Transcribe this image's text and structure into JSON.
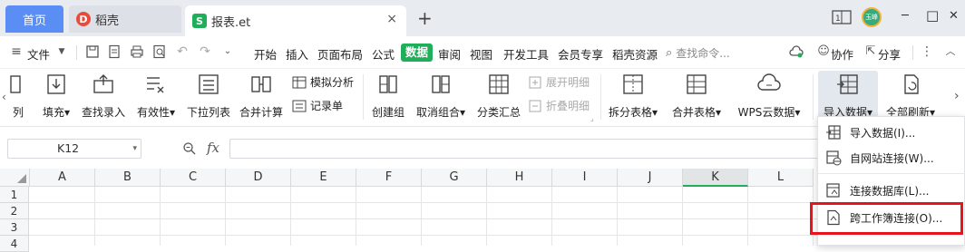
{
  "tabs": {
    "home": "首页",
    "daoke": "稻壳",
    "file": "报表.et",
    "close": "×",
    "new_tab": "+"
  },
  "window": {
    "avatar": "玉峰",
    "minimize": "─",
    "maximize": "□",
    "close": "✕"
  },
  "menu": {
    "file": "文件",
    "items": [
      "开始",
      "插入",
      "页面布局",
      "公式",
      "数据",
      "审阅",
      "视图",
      "开发工具",
      "会员专享",
      "稻壳资源"
    ],
    "search_placeholder": "查找命令...",
    "collab": "协作",
    "share": "分享"
  },
  "ribbon": {
    "partial": "列",
    "buttons": [
      "填充",
      "查找录入",
      "有效性",
      "下拉列表",
      "合并计算",
      "创建组",
      "取消组合",
      "分类汇总",
      "拆分表格",
      "合并表格",
      "WPS云数据",
      "导入数据",
      "全部刷新"
    ],
    "small": {
      "simulate": "模拟分析",
      "record": "记录单",
      "expand": "展开明细",
      "collapse": "折叠明细"
    }
  },
  "formula": {
    "cell_ref": "K12",
    "fx": "fx"
  },
  "grid": {
    "columns": [
      "A",
      "B",
      "C",
      "D",
      "E",
      "F",
      "G",
      "H",
      "I",
      "J",
      "K",
      "L"
    ],
    "rows": [
      "1",
      "2",
      "3",
      "4"
    ],
    "active_column": "K"
  },
  "dropdown": {
    "items": [
      "导入数据(I)...",
      "自网站连接(W)...",
      "连接数据库(L)...",
      "跨工作簿连接(O)..."
    ]
  },
  "colors": {
    "accent": "#1fae5a",
    "tab_home": "#5b8ef5",
    "highlight": "#e8141b"
  }
}
